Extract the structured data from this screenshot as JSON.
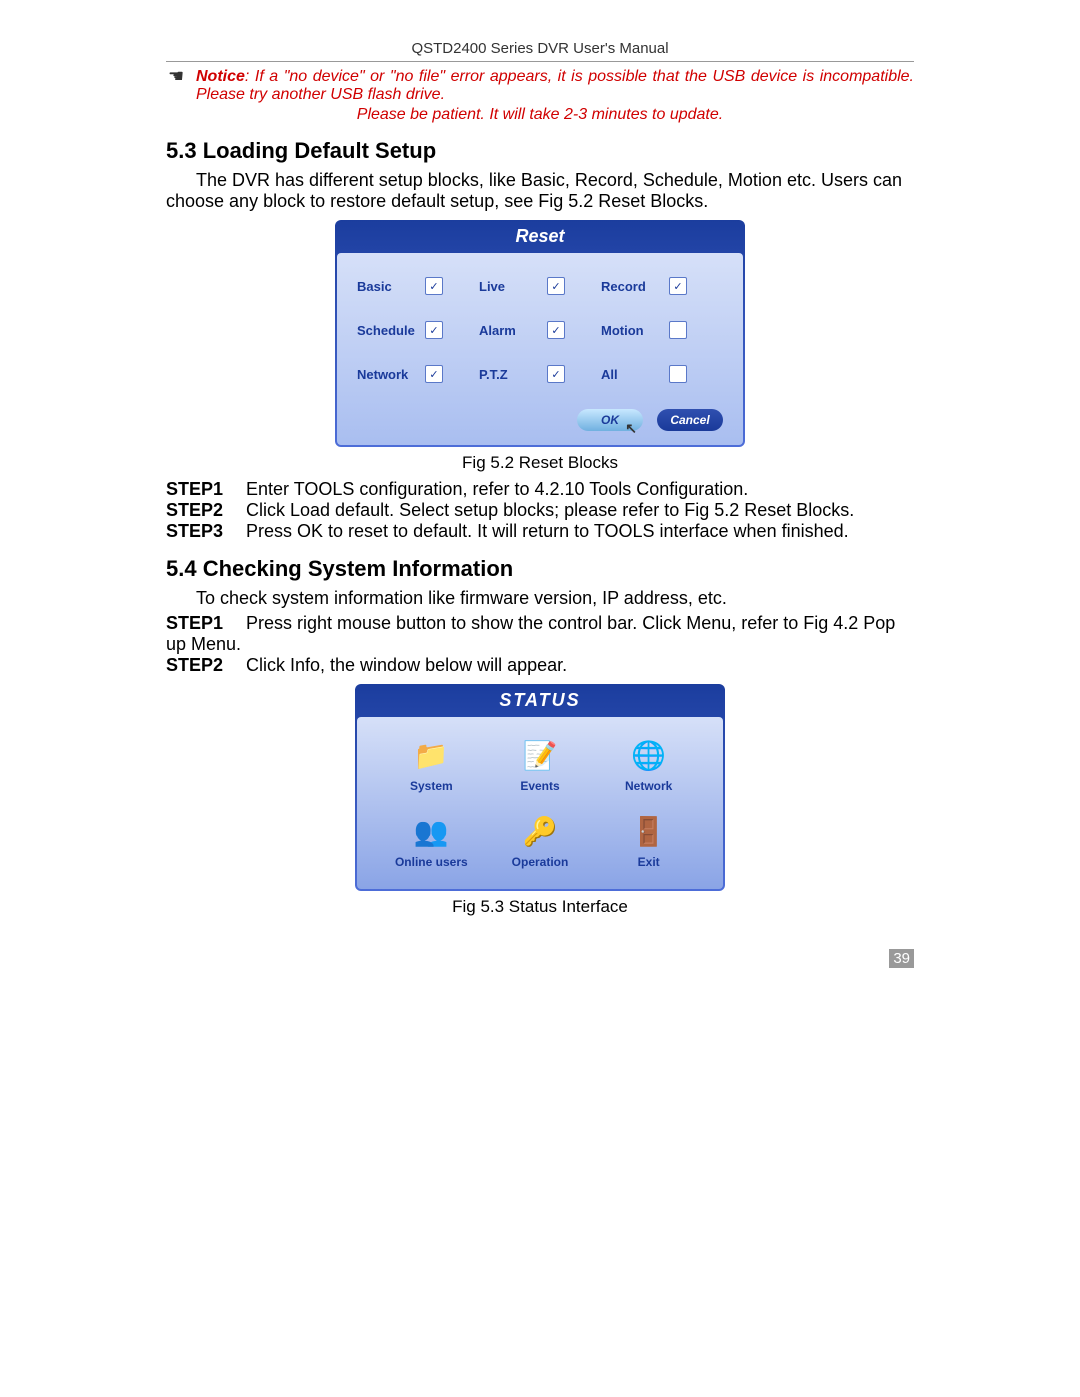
{
  "header": "QSTD2400 Series DVR User's Manual",
  "notice": {
    "label": "Notice",
    "text": ": If a \"no device\" or \"no file\" error appears, it is possible that the USB device is incompatible. Please try another USB flash drive."
  },
  "notice2": "Please be patient. It will take 2-3 minutes to update.",
  "section53": {
    "heading": "5.3  Loading Default Setup",
    "intro1": "The DVR has different setup blocks, like Basic, Record, Schedule, Motion etc. Users can choose any block to restore default setup, see Fig 5.2 Reset Blocks.",
    "reset": {
      "title": "Reset",
      "rows": [
        [
          {
            "label": "Basic",
            "checked": true
          },
          {
            "label": "Live",
            "checked": true
          },
          {
            "label": "Record",
            "checked": true
          }
        ],
        [
          {
            "label": "Schedule",
            "checked": true
          },
          {
            "label": "Alarm",
            "checked": true
          },
          {
            "label": "Motion",
            "checked": false
          }
        ],
        [
          {
            "label": "Network",
            "checked": true
          },
          {
            "label": "P.T.Z",
            "checked": true
          },
          {
            "label": "All",
            "checked": false
          }
        ]
      ],
      "ok": "OK",
      "cancel": "Cancel"
    },
    "figcaption": "Fig 5.2 Reset Blocks",
    "steps": [
      {
        "label": "STEP1",
        "text": "Enter TOOLS configuration, refer to 4.2.10 Tools Configuration."
      },
      {
        "label": "STEP2",
        "text": "Click Load default. Select setup blocks; please refer to Fig 5.2 Reset Blocks."
      },
      {
        "label": "STEP3",
        "text": "Press OK to reset to default. It will return to TOOLS interface when finished."
      }
    ]
  },
  "section54": {
    "heading": "5.4  Checking System Information",
    "intro": "To check system information like firmware version, IP address, etc.",
    "steps": [
      {
        "label": "STEP1",
        "text": "Press right mouse button to show the control bar. Click Menu, refer to Fig 4.2 Pop up Menu."
      },
      {
        "label": "STEP2",
        "text": "Click Info, the window below will appear."
      }
    ],
    "status": {
      "title": "STATUS",
      "items": [
        {
          "icon": "📁",
          "label": "System"
        },
        {
          "icon": "📝",
          "label": "Events"
        },
        {
          "icon": "🌐",
          "label": "Network"
        },
        {
          "icon": "👥",
          "label": "Online users"
        },
        {
          "icon": "🔑",
          "label": "Operation"
        },
        {
          "icon": "🚪",
          "label": "Exit"
        }
      ]
    },
    "figcaption": "Fig 5.3 Status Interface"
  },
  "pageNumber": "39"
}
